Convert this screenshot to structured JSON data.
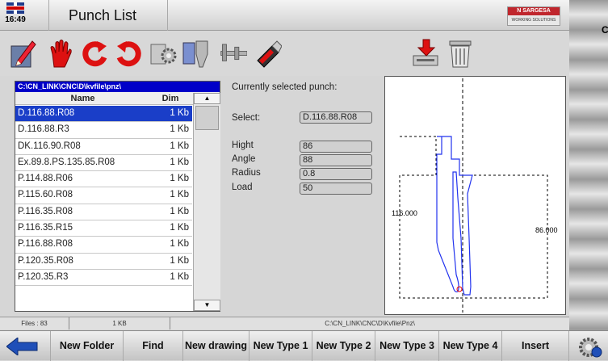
{
  "header": {
    "time": "16:49",
    "title": "Punch List",
    "logo_brand": "N SARGESA",
    "logo_sub": "WORKING SOLUTIONS",
    "edge_letter": "C"
  },
  "toolbar": {
    "icons": [
      "edit-icon",
      "hand-stop-icon",
      "rotate-left-icon",
      "rotate-right-icon",
      "tool-settings-icon",
      "punch-tool-icon",
      "caliper-icon",
      "usb-drive-icon",
      "import-icon",
      "trash-icon"
    ]
  },
  "file_list": {
    "path": "C:\\CN_LINK\\CNC\\D\\kvfile\\pnz\\",
    "col_name": "Name",
    "col_dim": "Dim",
    "rows": [
      {
        "name": "D.116.88.R08",
        "dim": "1 Kb"
      },
      {
        "name": "D.116.88.R3",
        "dim": "1 Kb"
      },
      {
        "name": "DK.116.90.R08",
        "dim": "1 Kb"
      },
      {
        "name": "Ex.89.8.PS.135.85.R08",
        "dim": "1 Kb"
      },
      {
        "name": "P.114.88.R06",
        "dim": "1 Kb"
      },
      {
        "name": "P.115.60.R08",
        "dim": "1 Kb"
      },
      {
        "name": "P.116.35.R08",
        "dim": "1 Kb"
      },
      {
        "name": "P.116.35.R15",
        "dim": "1 Kb"
      },
      {
        "name": "P.116.88.R08",
        "dim": "1 Kb"
      },
      {
        "name": "P.120.35.R08",
        "dim": "1 Kb"
      },
      {
        "name": "P.120.35.R3",
        "dim": "1 Kb"
      }
    ],
    "selected_index": 0
  },
  "details": {
    "heading": "Currently selected punch:",
    "select_label": "Select:",
    "select_value": "D.116.88.R08",
    "hight_label": "Hight",
    "hight_value": "86",
    "angle_label": "Angle",
    "angle_value": "88",
    "radius_label": "Radius",
    "radius_value": "0.8",
    "load_label": "Load",
    "load_value": "50"
  },
  "drawing": {
    "height_label": "116.000",
    "width_label": "86.000"
  },
  "status": {
    "files": "Files : 83",
    "size": "1 KB",
    "path": "C:\\CN_LINK\\CNC\\D\\Kvfile\\Pnz\\"
  },
  "fkeys": {
    "new_folder": "New Folder",
    "find": "Find",
    "new_drawing": "New drawing",
    "new_type1": "New Type 1",
    "new_type2": "New Type 2",
    "new_type3": "New Type 3",
    "new_type4": "New Type 4",
    "insert": "Insert"
  }
}
